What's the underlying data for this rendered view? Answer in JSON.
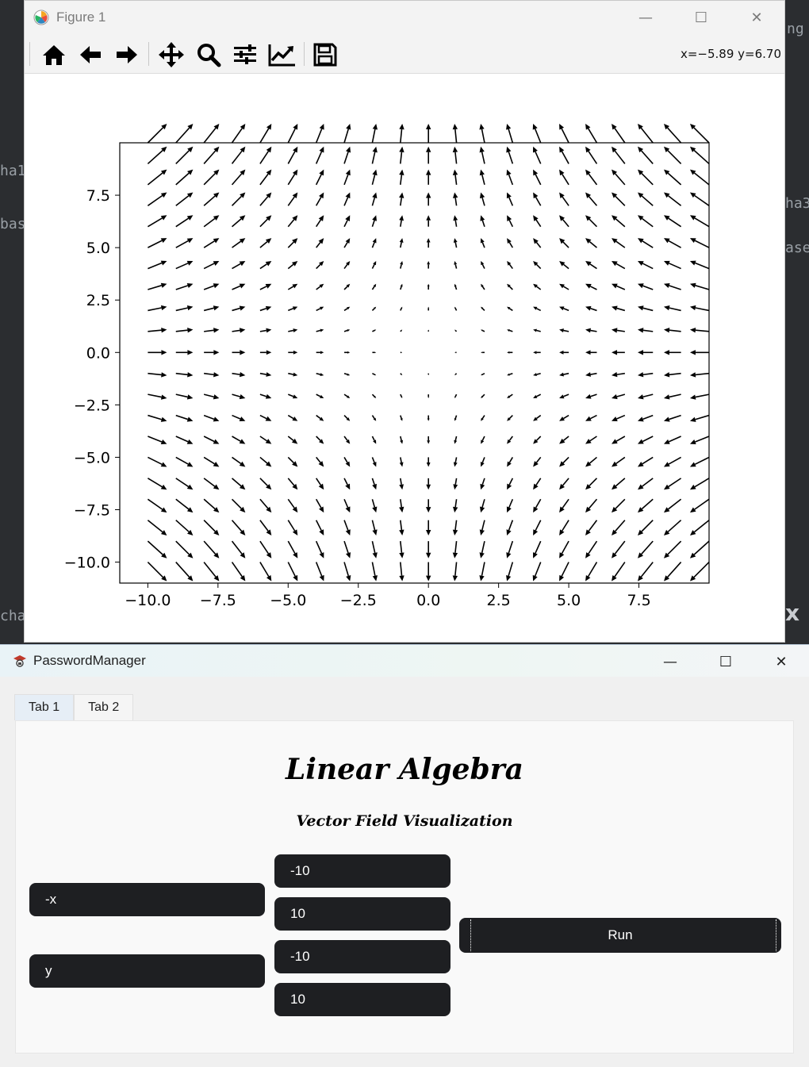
{
  "figure_window": {
    "title": "Figure 1",
    "controls": {
      "minimize": "—",
      "maximize": "☐",
      "close": "✕"
    },
    "toolbar": {
      "buttons": [
        "home-icon",
        "back-icon",
        "forward-icon",
        "pan-icon",
        "zoom-icon",
        "configure-subplots-icon",
        "edit-axis-icon",
        "save-icon"
      ],
      "coords": "x=−5.89 y=6.70"
    }
  },
  "chart_data": {
    "type": "quiver",
    "u_expr": "-x",
    "v_expr": "y",
    "x_range": [
      -10,
      10
    ],
    "y_range": [
      -10,
      10
    ],
    "grid_n": 21,
    "x_ticks": [
      "−10.0",
      "−7.5",
      "−5.0",
      "−2.5",
      "0.0",
      "2.5",
      "5.0",
      "7.5"
    ],
    "y_ticks": [
      "7.5",
      "5.0",
      "2.5",
      "0.0",
      "−2.5",
      "−5.0",
      "−7.5",
      "−10.0"
    ],
    "xlim": [
      -11,
      10
    ],
    "ylim": [
      -11,
      10
    ],
    "arrow_color": "#000000"
  },
  "password_manager": {
    "title": "PasswordManager",
    "controls": {
      "minimize": "—",
      "maximize": "☐",
      "close": "✕"
    },
    "tabs": [
      {
        "label": "Tab 1"
      },
      {
        "label": "Tab 2"
      }
    ],
    "heading": "Linear Algebra",
    "subheading": "Vector Field Visualization",
    "u_field": "-x",
    "v_field": "y",
    "x_min": "-10",
    "x_max": "10",
    "y_min": "-10",
    "y_max": "10",
    "run_label": "Run"
  },
  "background": {
    "fragments": [
      "ha1",
      "bas",
      "chat",
      "ha3",
      "ase",
      "ng",
      "x"
    ]
  }
}
